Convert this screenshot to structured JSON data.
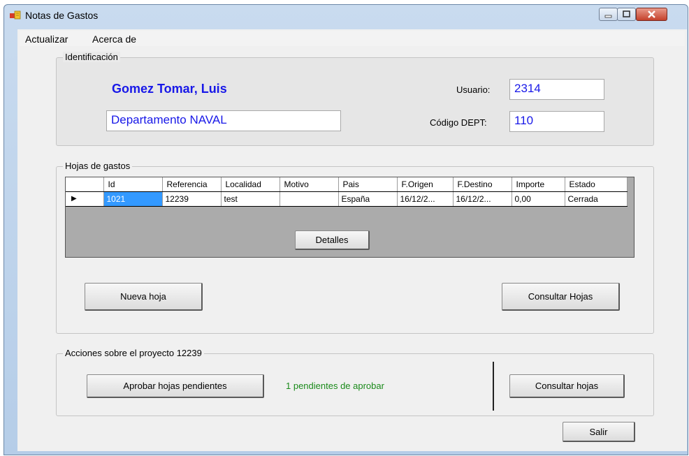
{
  "window": {
    "title": "Notas de Gastos"
  },
  "menu": {
    "items": [
      "Actualizar",
      "Acerca de"
    ]
  },
  "identificacion": {
    "legend": "Identificación",
    "name": "Gomez Tomar, Luis",
    "department_value": "Departamento NAVAL",
    "usuario_label": "Usuario:",
    "usuario_value": "2314",
    "codigo_label": "Código DEPT:",
    "codigo_value": "110"
  },
  "hojas": {
    "legend": "Hojas de gastos",
    "columns": [
      "Id",
      "Referencia",
      "Localidad",
      "Motivo",
      "Pais",
      "F.Origen",
      "F.Destino",
      "Importe",
      "Estado"
    ],
    "rows": [
      {
        "indicator": "▶",
        "cells": [
          "1021",
          "12239",
          "test",
          "",
          "España",
          "16/12/2...",
          "16/12/2...",
          "0,00",
          "Cerrada"
        ]
      }
    ],
    "detalles_label": "Detalles",
    "nueva_label": "Nueva hoja",
    "consultar_label": "Consultar Hojas"
  },
  "acciones": {
    "legend": "Acciones sobre el proyecto 12239",
    "aprobar_label": "Aprobar hojas pendientes",
    "pending_text": "1 pendientes de aprobar",
    "consultar_label": "Consultar hojas"
  },
  "salir_label": "Salir",
  "colors": {
    "name_text": "#1818e8",
    "pending_text": "#1a8a1a",
    "selection": "#3399ff"
  }
}
